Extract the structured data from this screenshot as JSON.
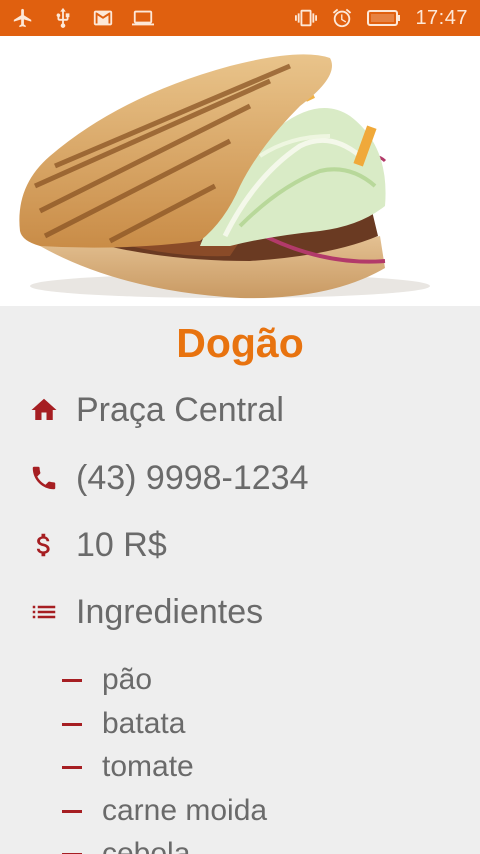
{
  "status_bar": {
    "time": "17:47",
    "icons_left": [
      "airplane-icon",
      "usb-icon",
      "gmail-icon",
      "laptop-icon"
    ],
    "icons_right": [
      "vibrate-icon",
      "alarm-icon",
      "battery-icon"
    ]
  },
  "hero": {
    "image": "sandwich-photo"
  },
  "place": {
    "name": "Dogão",
    "address": "Praça Central",
    "phone": "(43) 9998-1234",
    "price": "10 R$",
    "ingredients_label": "Ingredientes",
    "ingredients": [
      "pão",
      "batata",
      "tomate",
      "carne moida",
      "cebola"
    ]
  },
  "colors": {
    "status_bar": "#e0600f",
    "title": "#e8730f",
    "icon": "#a61e22",
    "text": "#6a6a6a",
    "background": "#eeeeee"
  }
}
